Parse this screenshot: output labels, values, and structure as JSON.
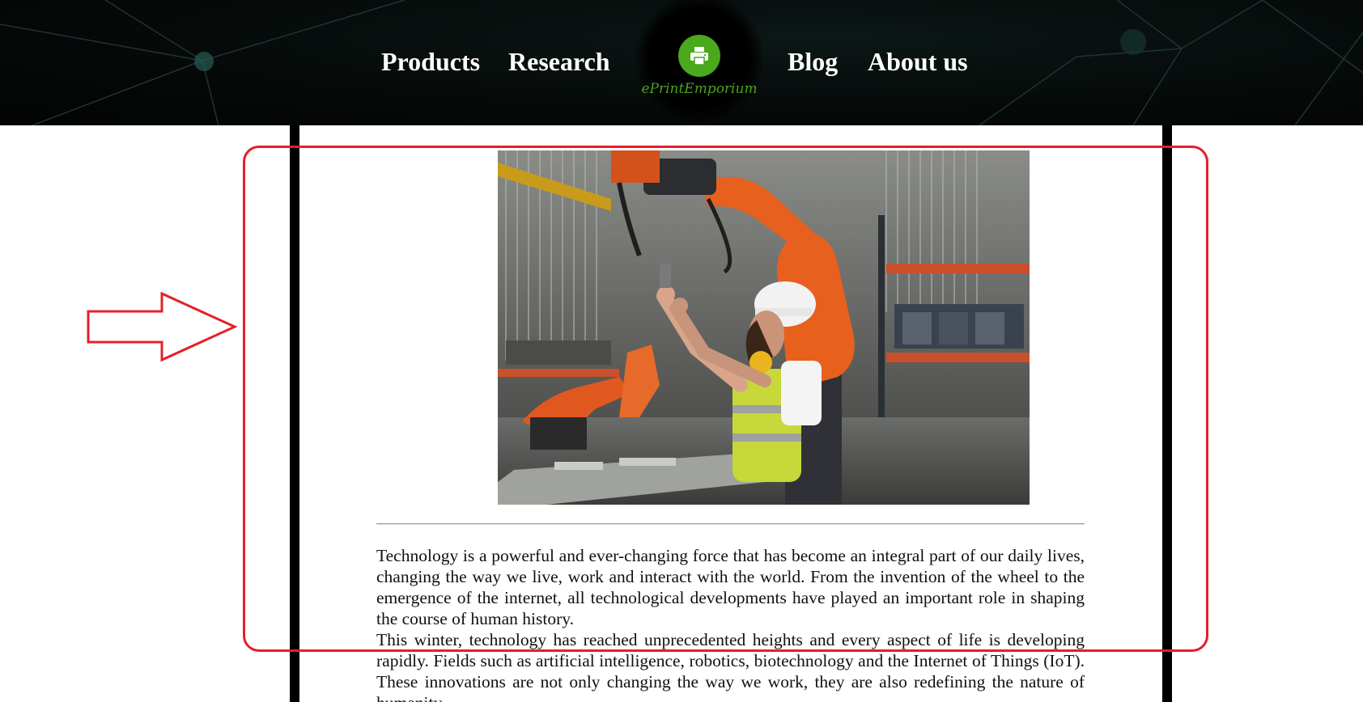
{
  "header": {
    "nav_left": [
      "Products",
      "Research"
    ],
    "nav_right": [
      "Blog",
      "About us"
    ],
    "logo_text": "ePrintEmporium",
    "logo_icon": "printer-icon",
    "logo_color": "#4aa81d"
  },
  "main": {
    "image_alt": "Engineer in hard hat and safety vest adjusting an orange industrial robot arm in a factory",
    "paragraphs": [
      "Technology is a powerful and ever-changing force that has become an integral part of our daily lives, changing the way we live, work and interact with the world. From the invention of the wheel to the emergence of the internet, all technological developments have played an important role in shaping the course of human history.",
      "This winter, technology has reached unprecedented heights and every aspect of life is developing rapidly. Fields such as artificial intelligence, robotics, biotechnology and the Internet of Things (IoT). These innovations are not only changing the way we work, they are also redefining the nature of humanity."
    ]
  },
  "annotation": {
    "color": "#e3202a",
    "arrow_icon": "right-arrow-icon"
  }
}
